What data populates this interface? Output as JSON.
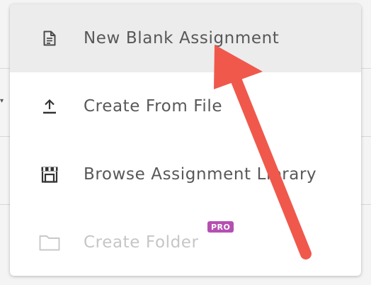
{
  "menu": {
    "items": [
      {
        "label": "New Blank Assignment",
        "icon": "document-icon",
        "state": "highlighted"
      },
      {
        "label": "Create From File",
        "icon": "upload-icon",
        "state": "normal"
      },
      {
        "label": "Browse Assignment Library",
        "icon": "storefront-icon",
        "state": "normal"
      },
      {
        "label": "Create Folder",
        "icon": "folder-icon",
        "state": "disabled",
        "badge": "PRO"
      }
    ]
  },
  "colors": {
    "highlight_bg": "#ececec",
    "label_text": "#585858",
    "disabled_text": "#c6c6c6",
    "pro_badge": "#b54fb1",
    "annotation_arrow": "#f0584c"
  }
}
